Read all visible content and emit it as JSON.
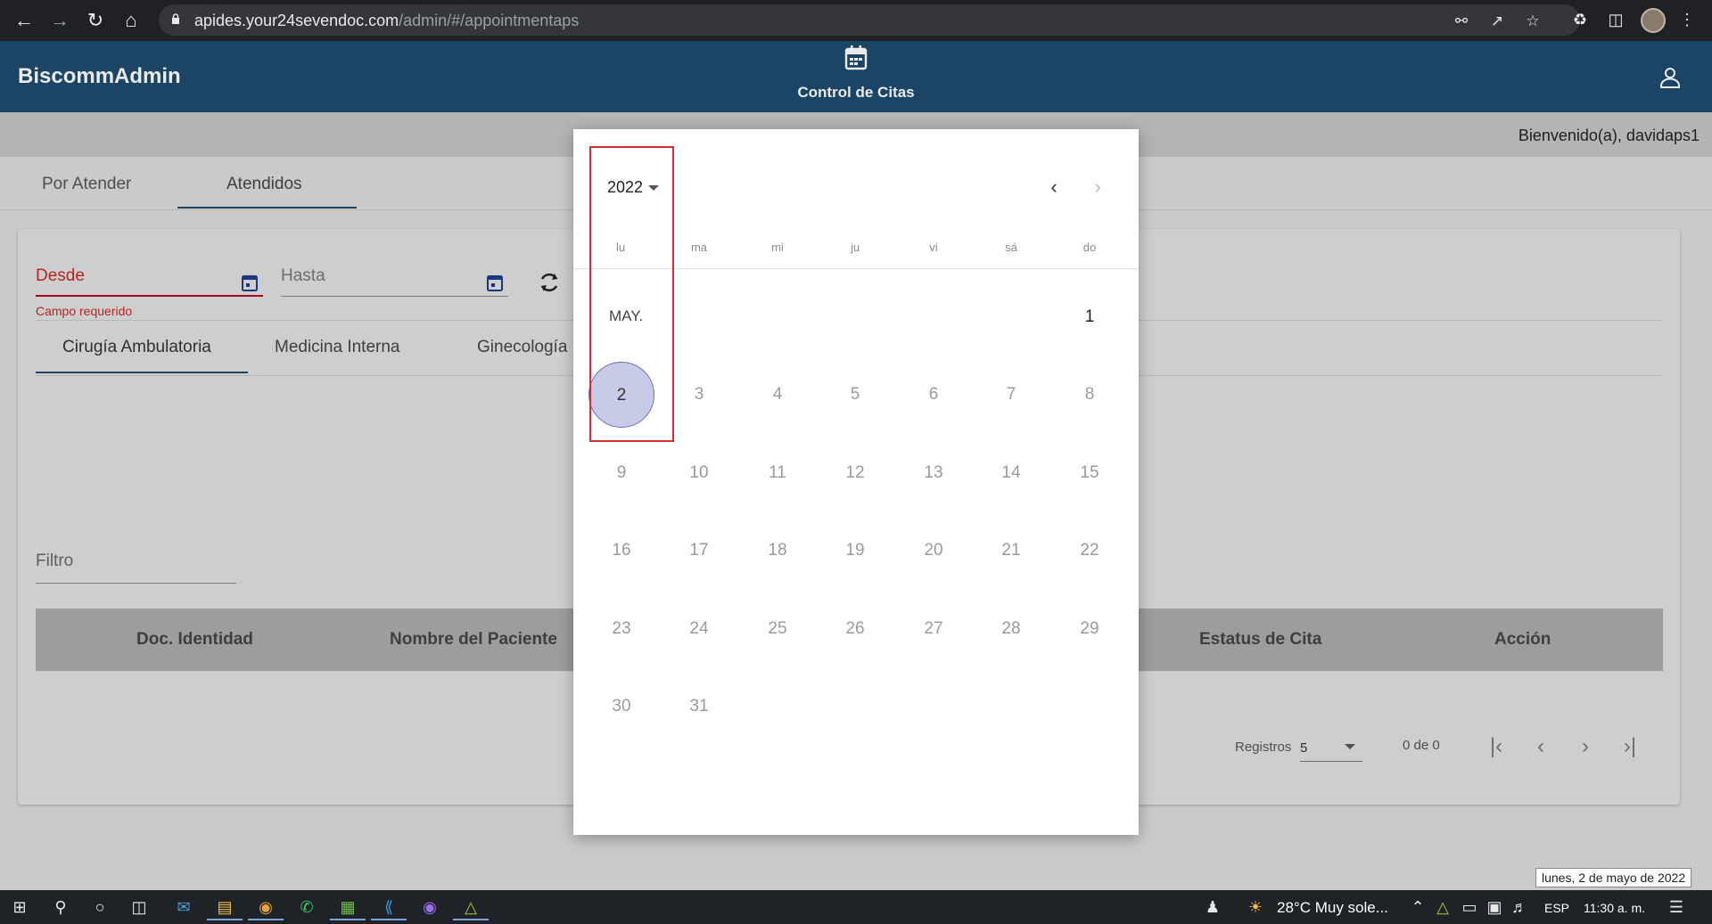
{
  "browser": {
    "url_host": "apides.your24sevendoc.com",
    "url_path": "/admin/#/appointmentaps"
  },
  "app": {
    "brand": "BiscommAdmin",
    "center_nav_label": "Control de Citas",
    "welcome": "Bienvenido(a), davidaps1"
  },
  "tabs": [
    "Por Atender",
    "Atendidos"
  ],
  "filters": {
    "desde_label": "Desde",
    "hasta_label": "Hasta",
    "error_text": "Campo requerido",
    "filtro_label": "Filtro"
  },
  "subtabs": [
    "Cirugía Ambulatoria",
    "Medicina Interna",
    "Ginecología"
  ],
  "table": {
    "headers": [
      "Doc. Identidad",
      "Nombre del Paciente",
      "Estatus de Cita",
      "Acción"
    ]
  },
  "paginator": {
    "registros_label": "Registros",
    "page_size": "5",
    "range": "0 de 0"
  },
  "datepicker": {
    "year": "2022",
    "weekdays": [
      "lu",
      "ma",
      "mi",
      "ju",
      "vi",
      "sá",
      "do"
    ],
    "month_label": "MAY.",
    "days": [
      "1",
      "2",
      "3",
      "4",
      "5",
      "6",
      "7",
      "8",
      "9",
      "10",
      "11",
      "12",
      "13",
      "14",
      "15",
      "16",
      "17",
      "18",
      "19",
      "20",
      "21",
      "22",
      "23",
      "24",
      "25",
      "26",
      "27",
      "28",
      "29",
      "30",
      "31"
    ],
    "selected_day": "2"
  },
  "tooltip": "lunes, 2 de mayo de 2022",
  "taskbar": {
    "weather": "28°C  Muy sole...",
    "language": "ESP",
    "time": "11:30 a. m."
  }
}
